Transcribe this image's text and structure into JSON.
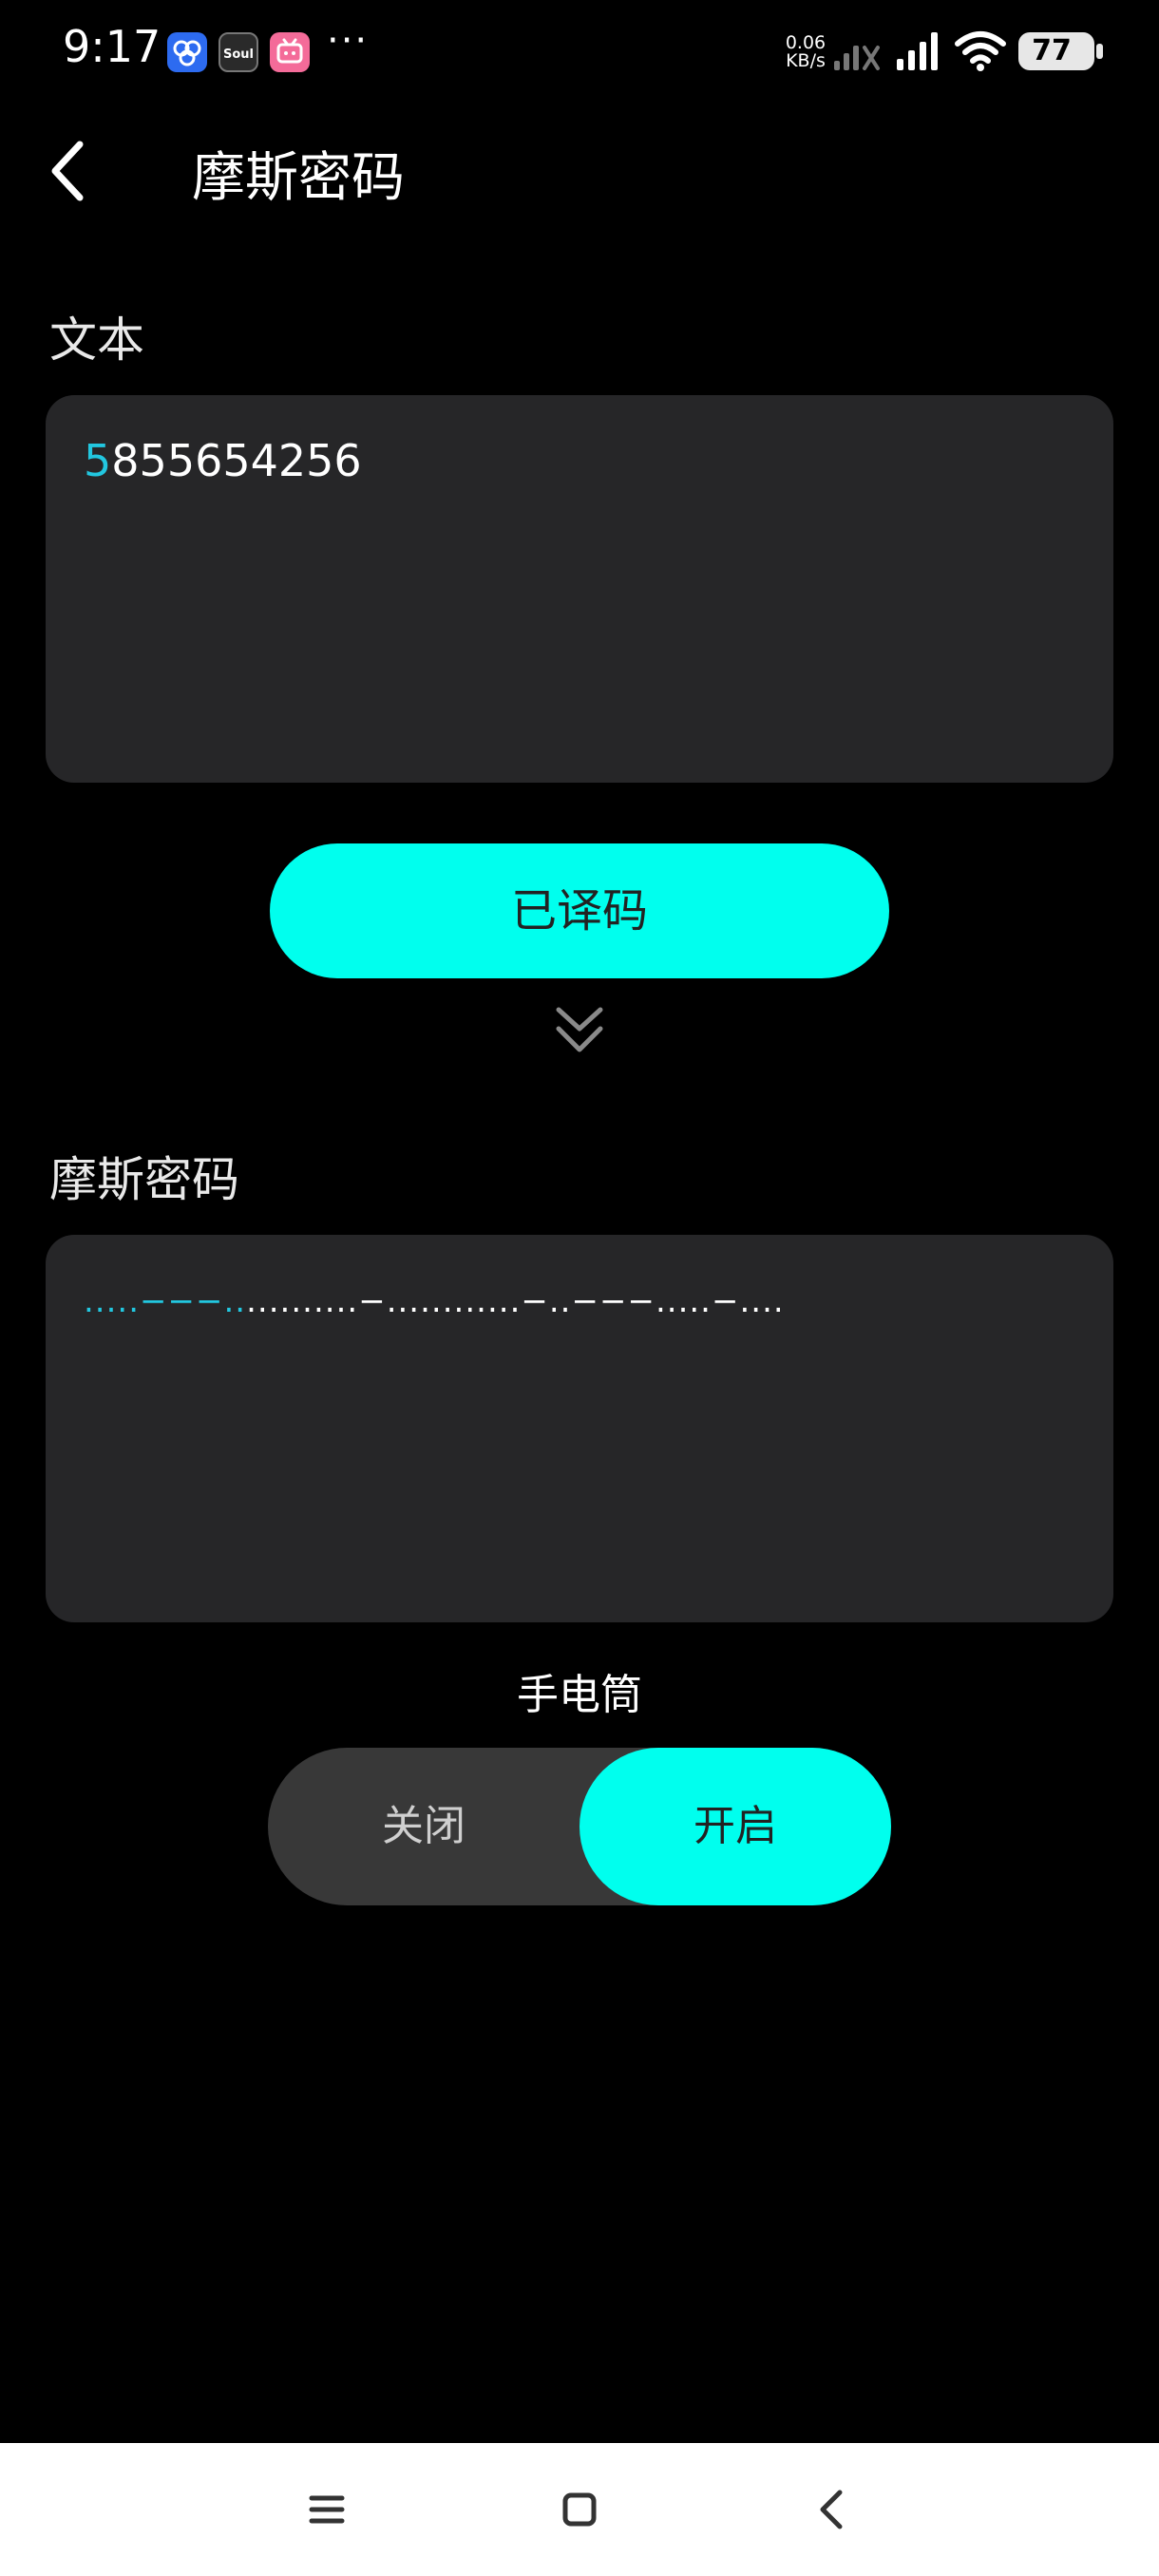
{
  "status": {
    "time": "9:17",
    "more": "···",
    "net_speed_value": "0.06",
    "net_speed_unit": "KB/s",
    "battery": "77",
    "icons": [
      "baidu-netdisk-icon",
      "soul-app-icon",
      "bilibili-icon",
      "signal-slash-icon",
      "signal-icon",
      "wifi-icon",
      "battery-icon"
    ]
  },
  "header": {
    "title": "摩斯密码"
  },
  "text_section": {
    "label": "文本",
    "value_highlight": "5",
    "value_rest": "855654256"
  },
  "decode_button": {
    "label": "已译码"
  },
  "morse_section": {
    "label": "摩斯密码",
    "morse_highlight": ".....−−−..",
    "morse_rest": "..........−............−..−−−.....−...."
  },
  "flashlight": {
    "label": "手电筒",
    "off_label": "关闭",
    "on_label": "开启",
    "state": "on"
  },
  "colors": {
    "accent": "#00ffee",
    "highlight_text": "#22c7e0",
    "card_bg": "#262628",
    "background": "#000000"
  },
  "nav": {
    "items": [
      "menu-icon",
      "home-icon",
      "back-icon"
    ]
  }
}
